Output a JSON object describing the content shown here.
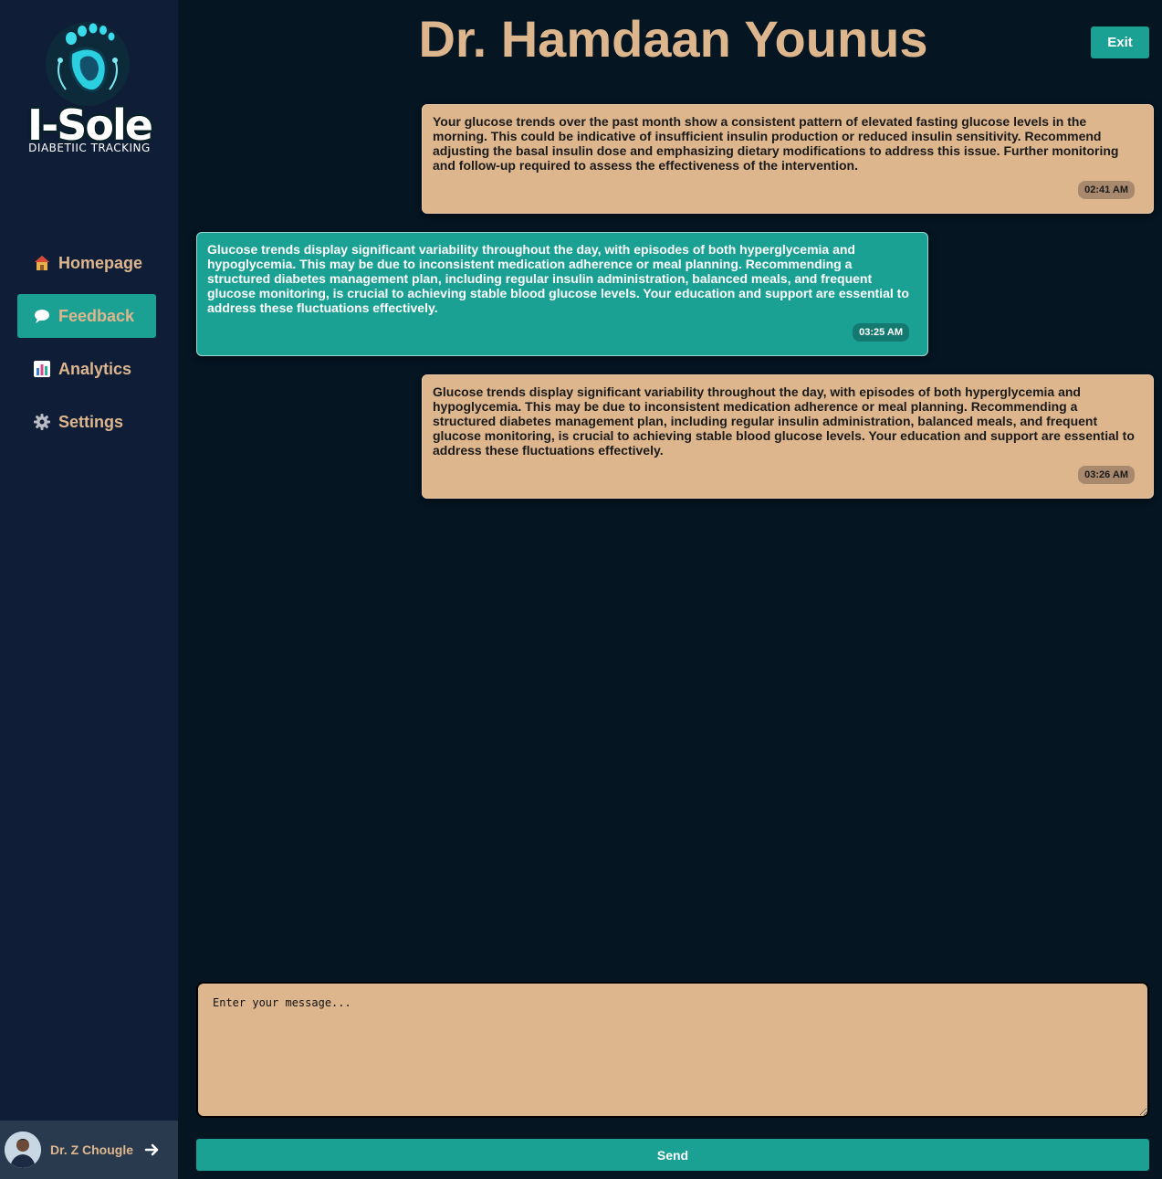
{
  "app": {
    "logo_text": "I-Sole",
    "logo_subtitle": "DIABETIIC TRACKING"
  },
  "sidebar": {
    "items": [
      {
        "label": "Homepage",
        "icon": "house-icon"
      },
      {
        "label": "Feedback",
        "icon": "speech-bubble-icon",
        "active": true
      },
      {
        "label": "Analytics",
        "icon": "bar-chart-icon"
      },
      {
        "label": "Settings",
        "icon": "gear-icon"
      }
    ],
    "user": {
      "name": "Dr. Z Chougle",
      "icon": "logout-arrow-icon"
    }
  },
  "header": {
    "title": "Dr. Hamdaan Younus",
    "exit_label": "Exit"
  },
  "messages": [
    {
      "side": "right",
      "text": "Your glucose trends over the past month show a consistent pattern of elevated fasting glucose levels in the morning. This could be indicative of insufficient insulin production or reduced insulin sensitivity. Recommend adjusting the basal insulin dose and emphasizing dietary modifications to address this issue. Further monitoring and follow-up required to assess the effectiveness of the intervention.",
      "time": "02:41 AM"
    },
    {
      "side": "left",
      "text": "Glucose trends display significant variability throughout the day, with episodes of both hyperglycemia and hypoglycemia. This may be due to inconsistent medication adherence or meal planning. Recommending a structured diabetes management plan, including regular insulin administration, balanced meals, and frequent glucose monitoring, is crucial to achieving stable blood glucose levels. Your education and support are essential to address these fluctuations effectively.",
      "time": "03:25 AM"
    },
    {
      "side": "right",
      "text": "Glucose trends display significant variability throughout the day, with episodes of both hyperglycemia and hypoglycemia. This may be due to inconsistent medication adherence or meal planning. Recommending a structured diabetes management plan, including regular insulin administration, balanced meals, and frequent glucose monitoring, is crucial to achieving stable blood glucose levels. Your education and support are essential to address these fluctuations effectively.",
      "time": "03:26 AM"
    }
  ],
  "composer": {
    "placeholder": "Enter your message...",
    "value": "",
    "send_label": "Send"
  },
  "colors": {
    "background": "#051522",
    "sidebar": "#0f1e36",
    "accent_teal": "#1ba094",
    "accent_tan": "#deb68e"
  }
}
